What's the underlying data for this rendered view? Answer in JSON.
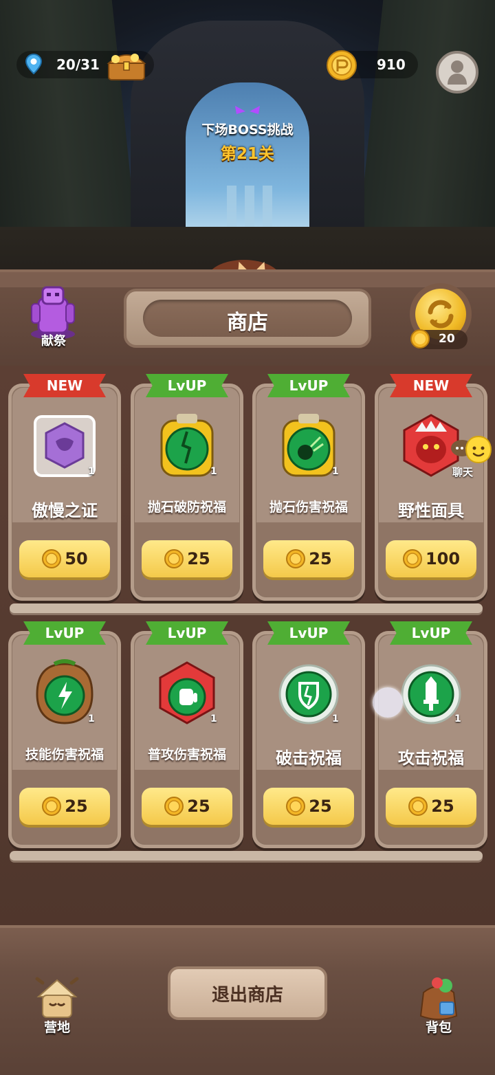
{
  "hud": {
    "stage_progress": "20/31",
    "coins": "910"
  },
  "boss": {
    "label": "下场BOSS挑战",
    "level": "第21关"
  },
  "header": {
    "title": "商店",
    "sacrifice_label": "献祭",
    "refresh_cost": "20"
  },
  "items": [
    {
      "badge": "NEW",
      "name": "傲慢之证",
      "price": "50",
      "count": "1",
      "icon": "pride-token-icon"
    },
    {
      "badge": "LvUP",
      "name": "抛石破防祝福",
      "price": "25",
      "count": "1",
      "icon": "stone-armor-break-icon"
    },
    {
      "badge": "LvUP",
      "name": "抛石伤害祝福",
      "price": "25",
      "count": "1",
      "icon": "stone-damage-icon"
    },
    {
      "badge": "NEW",
      "name": "野性面具",
      "price": "100",
      "count": "",
      "icon": "wild-mask-icon"
    },
    {
      "badge": "LvUP",
      "name": "技能伤害祝福",
      "price": "25",
      "count": "1",
      "icon": "skill-damage-icon"
    },
    {
      "badge": "LvUP",
      "name": "普攻伤害祝福",
      "price": "25",
      "count": "1",
      "icon": "attack-damage-icon"
    },
    {
      "badge": "LvUP",
      "name": "破击祝福",
      "price": "25",
      "count": "1",
      "icon": "break-strike-icon"
    },
    {
      "badge": "LvUP",
      "name": "攻击祝福",
      "price": "25",
      "count": "1",
      "icon": "attack-blessing-icon"
    }
  ],
  "chat": {
    "label": "聊天"
  },
  "bottom": {
    "exit_label": "退出商店",
    "camp_label": "营地",
    "bag_label": "背包"
  },
  "colors": {
    "new_badge": "#d83a2c",
    "lvup_badge": "#4fae34",
    "price_button": "#f4c94a",
    "boss_level": "#ffc52e"
  }
}
